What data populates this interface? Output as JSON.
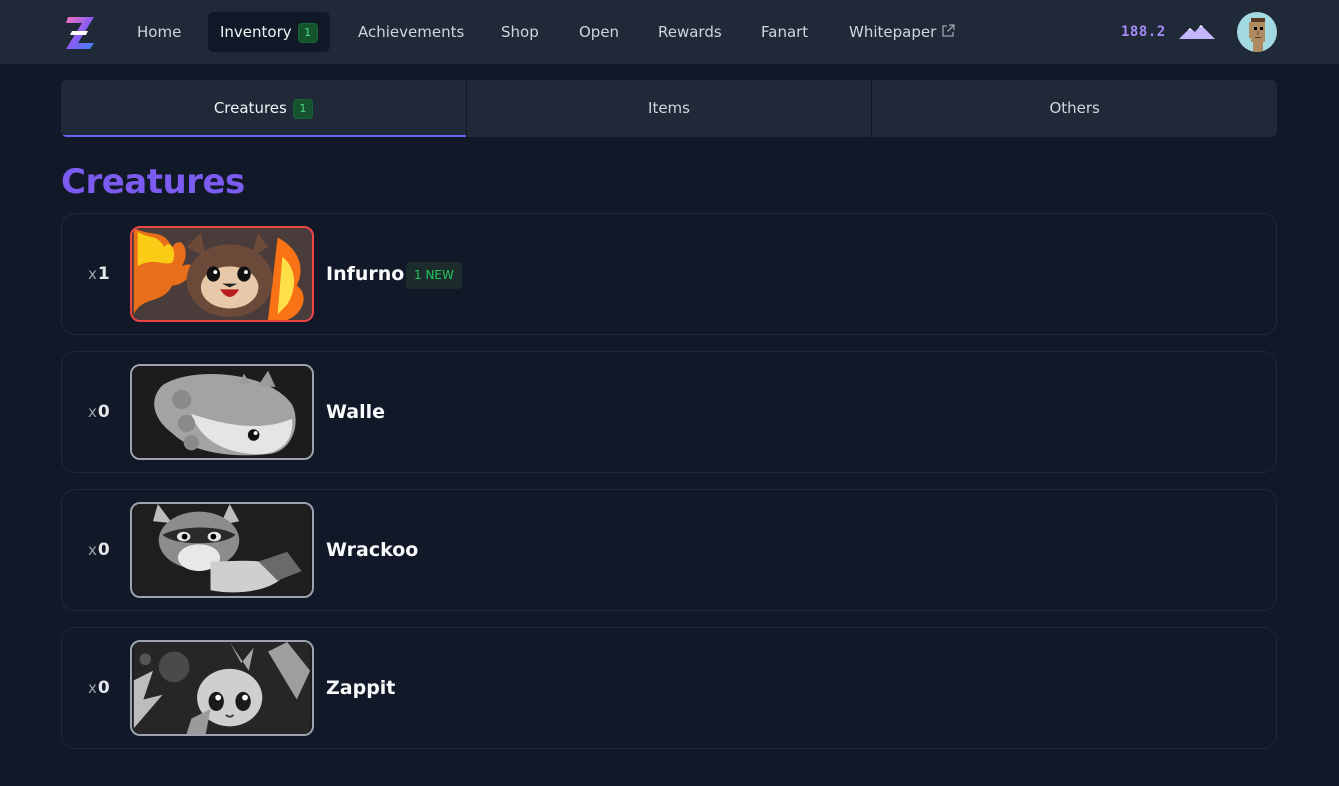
{
  "nav": {
    "items": [
      {
        "label": "Home"
      },
      {
        "label": "Inventory",
        "badge": "1"
      },
      {
        "label": "Achievements"
      },
      {
        "label": "Shop"
      },
      {
        "label": "Open"
      },
      {
        "label": "Rewards"
      },
      {
        "label": "Fanart"
      },
      {
        "label": "Whitepaper",
        "icon": "external-link-icon"
      }
    ],
    "balance": "188.2",
    "balance_icon": "mountain-icon",
    "avatar_icon": "pixel-avatar-icon"
  },
  "tabs": [
    {
      "label": "Creatures",
      "badge": "1",
      "active": true
    },
    {
      "label": "Items"
    },
    {
      "label": "Others"
    }
  ],
  "section": {
    "title": "Creatures"
  },
  "creatures": [
    {
      "qty_prefix": "x",
      "qty": "1",
      "name": "Infurno",
      "badge": "1 NEW",
      "owned": true
    },
    {
      "qty_prefix": "x",
      "qty": "0",
      "name": "Walle",
      "owned": false
    },
    {
      "qty_prefix": "x",
      "qty": "0",
      "name": "Wrackoo",
      "owned": false
    },
    {
      "qty_prefix": "x",
      "qty": "0",
      "name": "Zappit",
      "owned": false
    }
  ],
  "colors": {
    "background": "#111827",
    "surface": "#1f2937",
    "accent": "#7c5cf0",
    "tab_underline": "#6366f1",
    "badge_green": "#4ade80",
    "owned_border": "#ef4444"
  }
}
